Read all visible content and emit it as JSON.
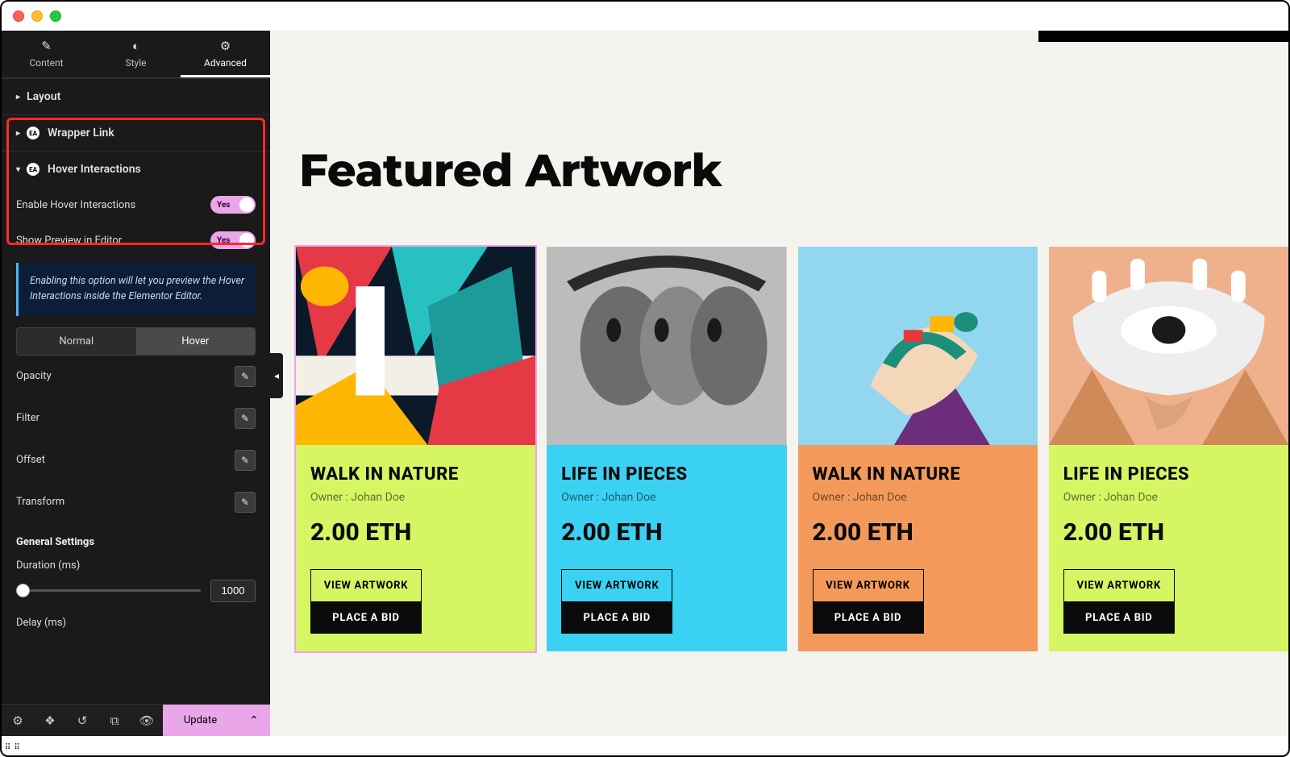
{
  "tabs": {
    "content": "Content",
    "style": "Style",
    "advanced": "Advanced"
  },
  "sections": {
    "layout": "Layout",
    "wrapper_link": "Wrapper Link",
    "hover_interactions": "Hover Interactions"
  },
  "badge_ea": "EA",
  "hover": {
    "enable_label": "Enable Hover Interactions",
    "enable_value": "Yes",
    "preview_label": "Show Preview in Editor",
    "preview_value": "Yes",
    "info": "Enabling this option will let you preview the Hover Interactions inside the Elementor Editor."
  },
  "state_tabs": {
    "normal": "Normal",
    "hover": "Hover"
  },
  "props": {
    "opacity": "Opacity",
    "filter": "Filter",
    "offset": "Offset",
    "transform": "Transform"
  },
  "general": {
    "header": "General Settings",
    "duration_label": "Duration (ms)",
    "duration_value": "1000",
    "delay_label": "Delay (ms)"
  },
  "bottom": {
    "update": "Update"
  },
  "page": {
    "heading": "Featured Artwork"
  },
  "cards": [
    {
      "title": "WALK IN NATURE",
      "owner": "Owner : Johan Doe",
      "price": "2.00 ETH",
      "view": "VIEW ARTWORK",
      "bid": "PLACE A BID"
    },
    {
      "title": "LIFE IN PIECES",
      "owner": "Owner : Johan Doe",
      "price": "2.00 ETH",
      "view": "VIEW ARTWORK",
      "bid": "PLACE A BID"
    },
    {
      "title": "WALK IN NATURE",
      "owner": "Owner : Johan Doe",
      "price": "2.00 ETH",
      "view": "VIEW ARTWORK",
      "bid": "PLACE A BID"
    },
    {
      "title": "LIFE IN PIECES",
      "owner": "Owner : Johan Doe",
      "price": "2.00 ETH",
      "view": "VIEW ARTWORK",
      "bid": "PLACE A BID"
    }
  ]
}
